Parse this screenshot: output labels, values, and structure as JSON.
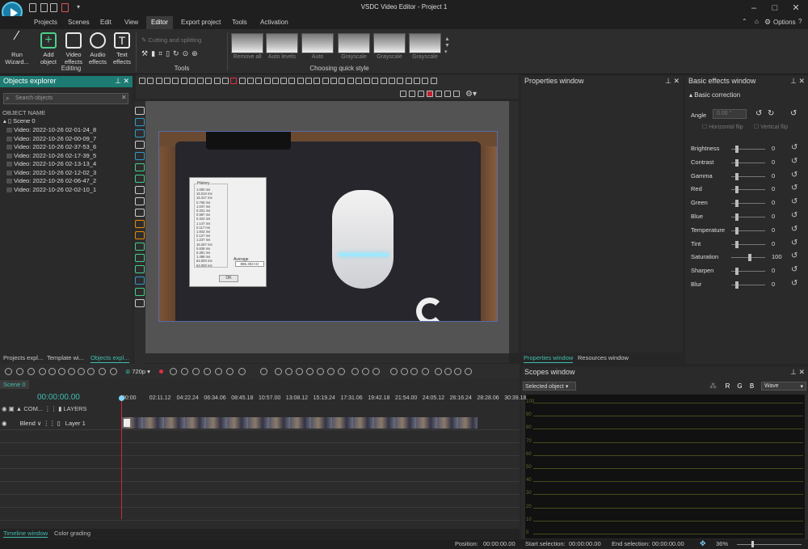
{
  "window": {
    "title": "VSDC Video Editor - Project 1"
  },
  "menu": [
    "Projects",
    "Scenes",
    "Edit",
    "View",
    "Editor",
    "Export project",
    "Tools",
    "Activation"
  ],
  "menu_right": {
    "options": "Options"
  },
  "ribbon": {
    "run_wizard": "Run\nWizard...",
    "add_object": "Add\nobject",
    "video_effects": "Video\neffects",
    "audio_effects": "Audio\neffects",
    "text_effects": "Text\neffects",
    "editing_group": "Editing",
    "cutting": "Cutting and splitting",
    "tools_group": "Tools",
    "quick_styles": [
      "Remove all",
      "Auto levels",
      "Auto",
      "Grayscale",
      "Grayscale",
      "Grayscale"
    ],
    "quick_group": "Choosing quick style"
  },
  "objects_explorer": {
    "title": "Objects explorer",
    "search_placeholder": "Search objects",
    "column": "OBJECT NAME",
    "scene": "Scene 0",
    "items": [
      "Video: 2022-10-26 02-01-24_8",
      "Video: 2022-10-26 02-00-09_7",
      "Video: 2022-10-26 02-37-53_6",
      "Video: 2022-10-26 02-17-39_5",
      "Video: 2022-10-26 02-13-13_4",
      "Video: 2022-10-26 02-12-02_3",
      "Video: 2022-10-26 02-06-47_2",
      "Video: 2022-10-26 02-02-10_1"
    ],
    "tabs": [
      "Projects expl...",
      "Template wi...",
      "Objects expl..."
    ]
  },
  "dialog": {
    "history_label": "History",
    "values": [
      "1.000 ms",
      "15.016 ms",
      "15.317 ms",
      "0.755 ms",
      "1.047 ms",
      "0.331 ms",
      "0.987 ms",
      "0.324 ms",
      "1.147 ms",
      "0.117 ms",
      "1.842 ms",
      "0.127 ms",
      "1.237 ms",
      "16.267 ms",
      "0.839 ms",
      "5.381 ms",
      "1.488 ms",
      "64.000 ms",
      "64.000 ms"
    ],
    "average_label": "Average",
    "average_value": "886.303 Hz",
    "ok": "OK"
  },
  "properties": {
    "title": "Properties window",
    "tabs": [
      "Properties window",
      "Resources window"
    ]
  },
  "basic_effects": {
    "title": "Basic effects window",
    "section": "Basic correction",
    "angle_label": "Angle",
    "angle_value": "0.00 °",
    "hflip": "Horizontal flip",
    "vflip": "Vertical flip",
    "rows": [
      {
        "label": "Brightness",
        "value": "0",
        "pos": 0.12
      },
      {
        "label": "Contrast",
        "value": "0",
        "pos": 0.12
      },
      {
        "label": "Gamma",
        "value": "0",
        "pos": 0.12
      },
      {
        "label": "Red",
        "value": "0",
        "pos": 0.12
      },
      {
        "label": "Green",
        "value": "0",
        "pos": 0.12
      },
      {
        "label": "Blue",
        "value": "0",
        "pos": 0.12
      },
      {
        "label": "Temperature",
        "value": "0",
        "pos": 0.12
      },
      {
        "label": "Tint",
        "value": "0",
        "pos": 0.12
      },
      {
        "label": "Saturation",
        "value": "100",
        "pos": 0.5
      },
      {
        "label": "Sharpen",
        "value": "0",
        "pos": 0.12
      },
      {
        "label": "Blur",
        "value": "0",
        "pos": 0.12
      }
    ]
  },
  "player": {
    "resolution": "720p"
  },
  "timeline": {
    "scene_tab": "Scene 0",
    "time": "00:00:00.00",
    "com_label": "COM...",
    "layers_label": "LAYERS",
    "blend": "Blend",
    "layer": "Layer 1",
    "ticks": [
      "00:00",
      "02:11.12",
      "04:22.24",
      "06:34.06",
      "08:45.18",
      "10:57.00",
      "13:08.12",
      "15:19.24",
      "17:31.06",
      "19:42.18",
      "21:54.00",
      "24:05.12",
      "26:16.24",
      "28:28.06",
      "30:39.18"
    ],
    "tabs": [
      "Timeline window",
      "Color grading"
    ]
  },
  "scopes": {
    "title": "Scopes window",
    "dropdown": "Selected object",
    "mode": "Wave",
    "channels": [
      "R",
      "G",
      "B"
    ],
    "channel_colors": [
      "#e0304a",
      "#2cc36b",
      "#2aa8e0"
    ],
    "y_ticks": [
      "100",
      "90",
      "80",
      "70",
      "60",
      "50",
      "40",
      "30",
      "20",
      "10",
      "0"
    ]
  },
  "status": {
    "position_label": "Position:",
    "position_value": "00:00:00.00",
    "start_label": "Start selection:",
    "start_value": "00:00:00.00",
    "end_label": "End selection:",
    "end_value": "00:00:00.00",
    "zoom": "36%"
  }
}
